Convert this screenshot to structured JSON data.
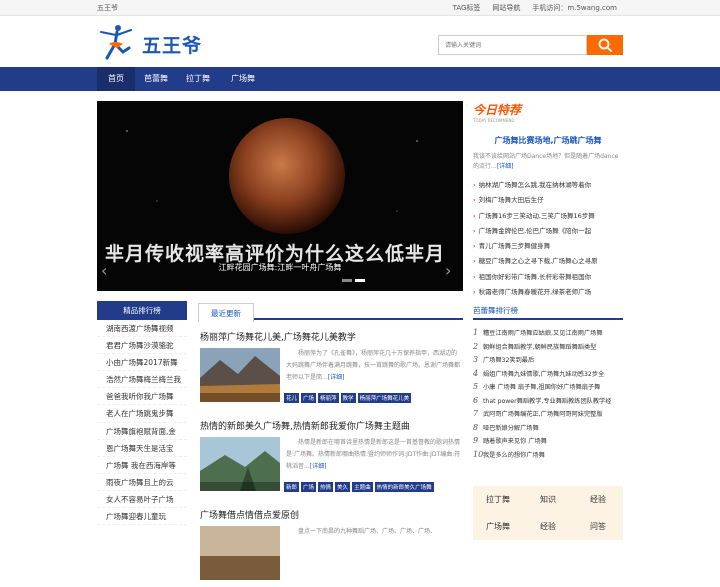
{
  "topbar": {
    "site_name": "五王爷",
    "links": [
      "TAG标签",
      "网站导航",
      "手机访问：m.5wang.com"
    ]
  },
  "header": {
    "logo_text": "五王爷",
    "search_placeholder": "请输入关键词"
  },
  "nav": {
    "items": [
      "首页",
      "芭蕾舞",
      "拉丁舞",
      "广场舞"
    ]
  },
  "banner": {
    "caption": "江畔花园广场舞:江畔一叶舟广场舞",
    "overlay_text": "芈月传收视率高评价为什么这么低芈月"
  },
  "today": {
    "title": "今日特荐",
    "subtitle": "TODAY RECOMMEND",
    "headline": "广场舞比赛场地,广场跳广场舞",
    "desc": "我该不该给网站广场Dance场地？但是随着广场dance的流行...",
    "desc_link": "[详细]",
    "items": [
      "纳林湖广场舞怎么跳,我在纳林湖等着你",
      "刘梅广场舞大田后生仔",
      "广场舞16步三笑动动,三笑广场舞16步舞",
      "广场舞金牌伦巴,伦巴广场舞《陪你一起",
      "青儿广场舞三步舞健身舞",
      "糖豆广场舞之心之寻下载,广场舞心之寻原",
      "祖国你好彩带广场舞,长杆彩带舞祖国你",
      "秋霜老师广场舞春暖花开,绿茶老师广场"
    ]
  },
  "rank": {
    "title": "精品排行榜",
    "items": [
      "湖南西渡广场舞视频",
      "君君广场舞沙漠骆驼",
      "小由广场舞2017新舞",
      "浩然广场舞梅兰梅兰我",
      "爸爸我听你我广场舞",
      "老人在广场跳鬼步舞",
      "广场舞旗袍赋背面,金",
      "恩广场舞天生是活宝",
      "广场舞 我在西海岸等",
      "雨夜广场舞且上的云",
      "女人不容易叶子广场",
      "广场舞迎春儿童玩"
    ]
  },
  "latest": {
    "tab": "最近更新",
    "articles": [
      {
        "title": "杨丽萍广场舞花儿美,广场舞花儿美教学",
        "summary": "杨丽萍为了《孔雀舞》，杨丽萍花几十万保养指甲，西湖边的大妈跳舞广场伴着满月跳舞，技一首跳舞的歌广场。恩谢广场舞都老师以下是简...",
        "more": "[详细]",
        "tags": [
          "花儿",
          "广场",
          "杨丽萍",
          "教学",
          "杨丽萍广场舞花儿美"
        ]
      },
      {
        "title": "热情的新郎美久广场舞,热情新郎我爱你广场舞主题曲",
        "summary": "热情是新郎在哪首诗里热情是新郎这是一首基督教的歌词热情是:广场舞。热情新郎哪曲热情:暨约师师作词:JDT作曲:JDT编曲:符桃滔音...",
        "more": "[详细]",
        "tags": [
          "新郎",
          "广场",
          "热情",
          "美久",
          "主题曲",
          "热情的新郎美久广场舞"
        ]
      },
      {
        "title": "广场舞借点情借点爱原创",
        "summary": "盘点一下南昌的九种舞蹈广场、广场、广场、广场、",
        "more": "",
        "tags": []
      }
    ]
  },
  "rank2": {
    "title": "芭蕾舞排行榜",
    "items": [
      "糟豆江南雨广场舞应姑娘,又见江南雨广场舞",
      "朝鲜组合舞蹈教学,朝鲜民族舞蹈舞蹈类型",
      "广场舞32笑到最后",
      "娟姐广场舞九妹情歌,广场舞九妹动感32步全",
      "小康 广场舞 扇子舞,祖国你好广场舞扇子舞",
      "that power舞蹈教学,专业舞蹈教练团队教学经",
      "武阿哥广场舞编花正,广场舞阿哥阿妹完整版",
      "哑巴新娘分解广场舞",
      "踏着歌声来见你 广场舞",
      "我是多么的想你广场舞"
    ]
  },
  "tagbox": {
    "tags": [
      "拉丁舞",
      "知识",
      "经验",
      "广场舞",
      "经验",
      "问答"
    ]
  },
  "colors": {
    "nav_blue": "#233c8a",
    "accent_orange": "#ff6a00",
    "link_blue": "#1a56b8"
  }
}
